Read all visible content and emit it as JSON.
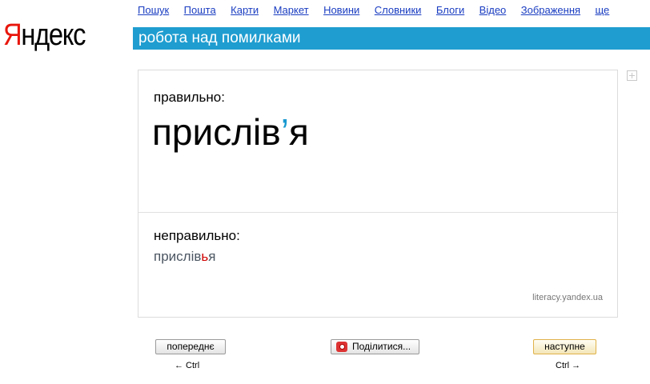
{
  "logo": {
    "first": "Я",
    "rest": "ндекс"
  },
  "nav": {
    "items": [
      "Пошук",
      "Пошта",
      "Карти",
      "Маркет",
      "Новини",
      "Словники",
      "Блоги",
      "Відео",
      "Зображення",
      "ще"
    ]
  },
  "header": {
    "title": "робота над помилками"
  },
  "card": {
    "correct_label": "правильно:",
    "correct_word_before": "прислів",
    "correct_word_accent": "’",
    "correct_word_after": "я",
    "wrong_label": "неправильно:",
    "wrong_word_before": "прислів",
    "wrong_word_error": "ь",
    "wrong_word_after": "я",
    "source": "literacy.yandex.ua"
  },
  "buttons": {
    "prev_label": "попереднє",
    "share_label": "Поділитися...",
    "next_label": "наступне",
    "prev_hint": "← Ctrl",
    "next_hint": "Ctrl →"
  },
  "colors": {
    "header_bar": "#1f9dd0",
    "logo_red": "#e8160c",
    "link_blue": "#1a3dc1",
    "error_red": "#d10000"
  }
}
